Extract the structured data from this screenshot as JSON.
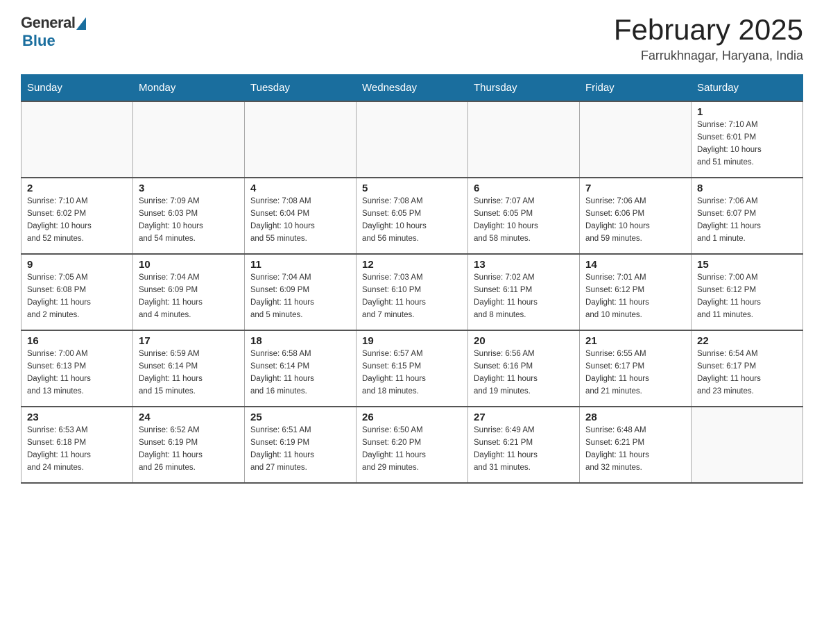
{
  "header": {
    "logo_general": "General",
    "logo_blue": "Blue",
    "month_title": "February 2025",
    "location": "Farrukhnagar, Haryana, India"
  },
  "days_of_week": [
    "Sunday",
    "Monday",
    "Tuesday",
    "Wednesday",
    "Thursday",
    "Friday",
    "Saturday"
  ],
  "weeks": [
    {
      "days": [
        {
          "date": "",
          "info": ""
        },
        {
          "date": "",
          "info": ""
        },
        {
          "date": "",
          "info": ""
        },
        {
          "date": "",
          "info": ""
        },
        {
          "date": "",
          "info": ""
        },
        {
          "date": "",
          "info": ""
        },
        {
          "date": "1",
          "info": "Sunrise: 7:10 AM\nSunset: 6:01 PM\nDaylight: 10 hours\nand 51 minutes."
        }
      ]
    },
    {
      "days": [
        {
          "date": "2",
          "info": "Sunrise: 7:10 AM\nSunset: 6:02 PM\nDaylight: 10 hours\nand 52 minutes."
        },
        {
          "date": "3",
          "info": "Sunrise: 7:09 AM\nSunset: 6:03 PM\nDaylight: 10 hours\nand 54 minutes."
        },
        {
          "date": "4",
          "info": "Sunrise: 7:08 AM\nSunset: 6:04 PM\nDaylight: 10 hours\nand 55 minutes."
        },
        {
          "date": "5",
          "info": "Sunrise: 7:08 AM\nSunset: 6:05 PM\nDaylight: 10 hours\nand 56 minutes."
        },
        {
          "date": "6",
          "info": "Sunrise: 7:07 AM\nSunset: 6:05 PM\nDaylight: 10 hours\nand 58 minutes."
        },
        {
          "date": "7",
          "info": "Sunrise: 7:06 AM\nSunset: 6:06 PM\nDaylight: 10 hours\nand 59 minutes."
        },
        {
          "date": "8",
          "info": "Sunrise: 7:06 AM\nSunset: 6:07 PM\nDaylight: 11 hours\nand 1 minute."
        }
      ]
    },
    {
      "days": [
        {
          "date": "9",
          "info": "Sunrise: 7:05 AM\nSunset: 6:08 PM\nDaylight: 11 hours\nand 2 minutes."
        },
        {
          "date": "10",
          "info": "Sunrise: 7:04 AM\nSunset: 6:09 PM\nDaylight: 11 hours\nand 4 minutes."
        },
        {
          "date": "11",
          "info": "Sunrise: 7:04 AM\nSunset: 6:09 PM\nDaylight: 11 hours\nand 5 minutes."
        },
        {
          "date": "12",
          "info": "Sunrise: 7:03 AM\nSunset: 6:10 PM\nDaylight: 11 hours\nand 7 minutes."
        },
        {
          "date": "13",
          "info": "Sunrise: 7:02 AM\nSunset: 6:11 PM\nDaylight: 11 hours\nand 8 minutes."
        },
        {
          "date": "14",
          "info": "Sunrise: 7:01 AM\nSunset: 6:12 PM\nDaylight: 11 hours\nand 10 minutes."
        },
        {
          "date": "15",
          "info": "Sunrise: 7:00 AM\nSunset: 6:12 PM\nDaylight: 11 hours\nand 11 minutes."
        }
      ]
    },
    {
      "days": [
        {
          "date": "16",
          "info": "Sunrise: 7:00 AM\nSunset: 6:13 PM\nDaylight: 11 hours\nand 13 minutes."
        },
        {
          "date": "17",
          "info": "Sunrise: 6:59 AM\nSunset: 6:14 PM\nDaylight: 11 hours\nand 15 minutes."
        },
        {
          "date": "18",
          "info": "Sunrise: 6:58 AM\nSunset: 6:14 PM\nDaylight: 11 hours\nand 16 minutes."
        },
        {
          "date": "19",
          "info": "Sunrise: 6:57 AM\nSunset: 6:15 PM\nDaylight: 11 hours\nand 18 minutes."
        },
        {
          "date": "20",
          "info": "Sunrise: 6:56 AM\nSunset: 6:16 PM\nDaylight: 11 hours\nand 19 minutes."
        },
        {
          "date": "21",
          "info": "Sunrise: 6:55 AM\nSunset: 6:17 PM\nDaylight: 11 hours\nand 21 minutes."
        },
        {
          "date": "22",
          "info": "Sunrise: 6:54 AM\nSunset: 6:17 PM\nDaylight: 11 hours\nand 23 minutes."
        }
      ]
    },
    {
      "days": [
        {
          "date": "23",
          "info": "Sunrise: 6:53 AM\nSunset: 6:18 PM\nDaylight: 11 hours\nand 24 minutes."
        },
        {
          "date": "24",
          "info": "Sunrise: 6:52 AM\nSunset: 6:19 PM\nDaylight: 11 hours\nand 26 minutes."
        },
        {
          "date": "25",
          "info": "Sunrise: 6:51 AM\nSunset: 6:19 PM\nDaylight: 11 hours\nand 27 minutes."
        },
        {
          "date": "26",
          "info": "Sunrise: 6:50 AM\nSunset: 6:20 PM\nDaylight: 11 hours\nand 29 minutes."
        },
        {
          "date": "27",
          "info": "Sunrise: 6:49 AM\nSunset: 6:21 PM\nDaylight: 11 hours\nand 31 minutes."
        },
        {
          "date": "28",
          "info": "Sunrise: 6:48 AM\nSunset: 6:21 PM\nDaylight: 11 hours\nand 32 minutes."
        },
        {
          "date": "",
          "info": ""
        }
      ]
    }
  ]
}
